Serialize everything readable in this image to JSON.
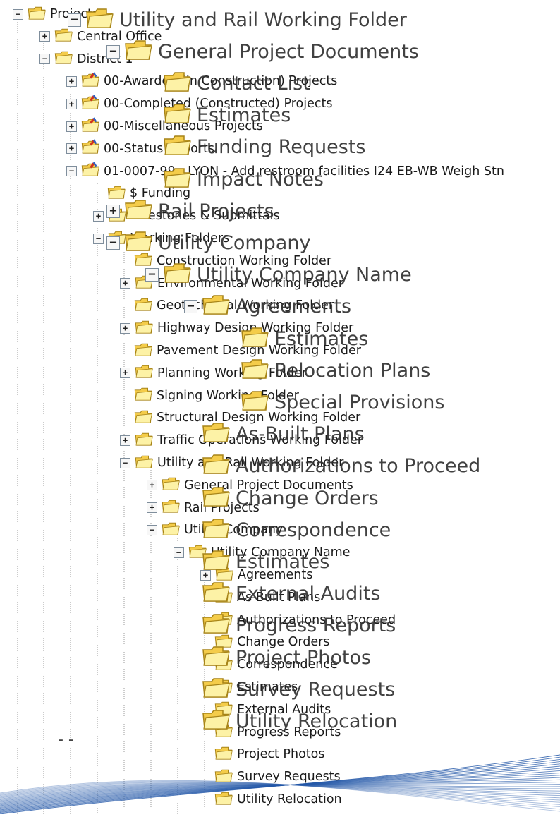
{
  "icons": {
    "folder": "folder-icon",
    "project_folder": "project-folder-icon",
    "expand": "plus-expand-icon",
    "collapse": "minus-collapse-icon"
  },
  "colors": {
    "folder_yellow": "#f4cc4a",
    "folder_light": "#fdf2a6",
    "folder_edge": "#a78418",
    "project_marker_red": "#d03020",
    "project_marker_blue": "#3060c0",
    "wave_blue": "#2458a8"
  },
  "small_tree": [
    {
      "id": "projects",
      "label": "Projects",
      "toggle": "minus",
      "icon": "folder"
    },
    {
      "id": "central-office",
      "label": "Central Office",
      "toggle": "plus",
      "icon": "folder"
    },
    {
      "id": "district-1",
      "label": "District 1",
      "toggle": "minus",
      "icon": "folder"
    },
    {
      "id": "awarded",
      "label": "00-Awarded (In Construction) Projects",
      "toggle": "plus",
      "icon": "project_folder"
    },
    {
      "id": "completed",
      "label": "00-Completed (Constructed) Projects",
      "toggle": "plus",
      "icon": "project_folder"
    },
    {
      "id": "misc",
      "label": "00-Miscellaneous Projects",
      "toggle": "plus",
      "icon": "project_folder"
    },
    {
      "id": "status",
      "label": "00-Status Reports",
      "toggle": "plus",
      "icon": "project_folder"
    },
    {
      "id": "lyon",
      "label": "01-0007-99 - LYON - Add restroom facilities I24 EB-WB Weigh Stn",
      "toggle": "minus",
      "icon": "project_folder"
    },
    {
      "id": "funding",
      "label": "$ Funding",
      "toggle": "none",
      "icon": "folder"
    },
    {
      "id": "milestones",
      "label": "Milestones & Submittals",
      "toggle": "plus",
      "icon": "folder"
    },
    {
      "id": "working-folders",
      "label": "Working Folders",
      "toggle": "minus",
      "icon": "folder"
    },
    {
      "id": "construction-wf",
      "label": "Construction Working Folder",
      "toggle": "none",
      "icon": "folder"
    },
    {
      "id": "environmental-wf",
      "label": "Environmental Working Folder",
      "toggle": "plus",
      "icon": "folder"
    },
    {
      "id": "geotechnical-wf",
      "label": "Geotechnical Working Folder",
      "toggle": "none",
      "icon": "folder"
    },
    {
      "id": "highway-design-wf",
      "label": "Highway Design Working Folder",
      "toggle": "plus",
      "icon": "folder"
    },
    {
      "id": "pavement-wf",
      "label": "Pavement Design Working Folder",
      "toggle": "none",
      "icon": "folder"
    },
    {
      "id": "planning-wf",
      "label": "Planning Working Folder",
      "toggle": "plus",
      "icon": "folder"
    },
    {
      "id": "signing-wf",
      "label": "Signing Working Folder",
      "toggle": "none",
      "icon": "folder"
    },
    {
      "id": "structural-wf",
      "label": "Structural Design Working Folder",
      "toggle": "none",
      "icon": "folder"
    },
    {
      "id": "traffic-wf",
      "label": "Traffic Operations Working Folder",
      "toggle": "plus",
      "icon": "folder"
    },
    {
      "id": "utility-rail-wf",
      "label": "Utility and Rail Working Folder",
      "toggle": "minus",
      "icon": "folder"
    },
    {
      "id": "general-docs",
      "label": "General Project Documents",
      "toggle": "plus",
      "icon": "folder"
    },
    {
      "id": "rail-projects",
      "label": "Rail Projects",
      "toggle": "plus",
      "icon": "folder"
    },
    {
      "id": "utility-company",
      "label": "Utility Company",
      "toggle": "minus",
      "icon": "folder"
    },
    {
      "id": "utility-company-name",
      "label": "Utility Company Name",
      "toggle": "minus",
      "icon": "folder"
    },
    {
      "id": "agreements",
      "label": "Agreements",
      "toggle": "plus",
      "icon": "folder"
    },
    {
      "id": "as-built",
      "label": "As-Built Plans",
      "toggle": "none",
      "icon": "folder"
    },
    {
      "id": "authorizations",
      "label": "Authorizations to Proceed",
      "toggle": "none",
      "icon": "folder"
    },
    {
      "id": "change-orders",
      "label": "Change Orders",
      "toggle": "none",
      "icon": "folder"
    },
    {
      "id": "correspondence",
      "label": "Correspondence",
      "toggle": "none",
      "icon": "folder"
    },
    {
      "id": "estimates",
      "label": "Estimates",
      "toggle": "none",
      "icon": "folder"
    },
    {
      "id": "external-audits",
      "label": "External Audits",
      "toggle": "none",
      "icon": "folder"
    },
    {
      "id": "progress-reports",
      "label": "Progress Reports",
      "toggle": "none",
      "icon": "folder"
    },
    {
      "id": "project-photos",
      "label": "Project Photos",
      "toggle": "none",
      "icon": "folder"
    },
    {
      "id": "survey-requests",
      "label": "Survey Requests",
      "toggle": "none",
      "icon": "folder"
    },
    {
      "id": "utility-relocation",
      "label": "Utility Relocation",
      "toggle": "none",
      "icon": "folder"
    }
  ],
  "big_tree": [
    {
      "id": "utility-rail",
      "label": "Utility and Rail Working Folder",
      "toggle": "minus"
    },
    {
      "id": "general-docs",
      "label": "General Project Documents",
      "toggle": "minus"
    },
    {
      "id": "contact-list",
      "label": "Contact List",
      "toggle": "none"
    },
    {
      "id": "estimates-top",
      "label": "Estimates",
      "toggle": "none"
    },
    {
      "id": "funding-requests",
      "label": "Funding Requests",
      "toggle": "none"
    },
    {
      "id": "impact-notes",
      "label": "Impact Notes",
      "toggle": "none"
    },
    {
      "id": "rail-projects",
      "label": "Rail Projects",
      "toggle": "plus"
    },
    {
      "id": "utility-company",
      "label": "Utility Company",
      "toggle": "minus"
    },
    {
      "id": "utility-company-name",
      "label": "Utility Company Name",
      "toggle": "minus"
    },
    {
      "id": "agreements",
      "label": "Agreements",
      "toggle": "minus"
    },
    {
      "id": "agreements-estimates",
      "label": "Estimates",
      "toggle": "none"
    },
    {
      "id": "relocation-plans",
      "label": "Relocation Plans",
      "toggle": "none"
    },
    {
      "id": "special-provisions",
      "label": "Special Provisions",
      "toggle": "none"
    },
    {
      "id": "as-built",
      "label": "As-Built Plans",
      "toggle": "none"
    },
    {
      "id": "authorizations",
      "label": "Authorizations to Proceed",
      "toggle": "none"
    },
    {
      "id": "change-orders",
      "label": "Change Orders",
      "toggle": "none"
    },
    {
      "id": "correspondence",
      "label": "Correspondence",
      "toggle": "none"
    },
    {
      "id": "estimates",
      "label": "Estimates",
      "toggle": "none"
    },
    {
      "id": "external-audits",
      "label": "External Audits",
      "toggle": "none"
    },
    {
      "id": "progress-reports",
      "label": "Progress Reports",
      "toggle": "none"
    },
    {
      "id": "project-photos",
      "label": "Project Photos",
      "toggle": "none"
    },
    {
      "id": "survey-requests",
      "label": "Survey Requests",
      "toggle": "none"
    },
    {
      "id": "utility-relocation",
      "label": "Utility Relocation",
      "toggle": "none"
    }
  ],
  "stray_mark": "- -"
}
